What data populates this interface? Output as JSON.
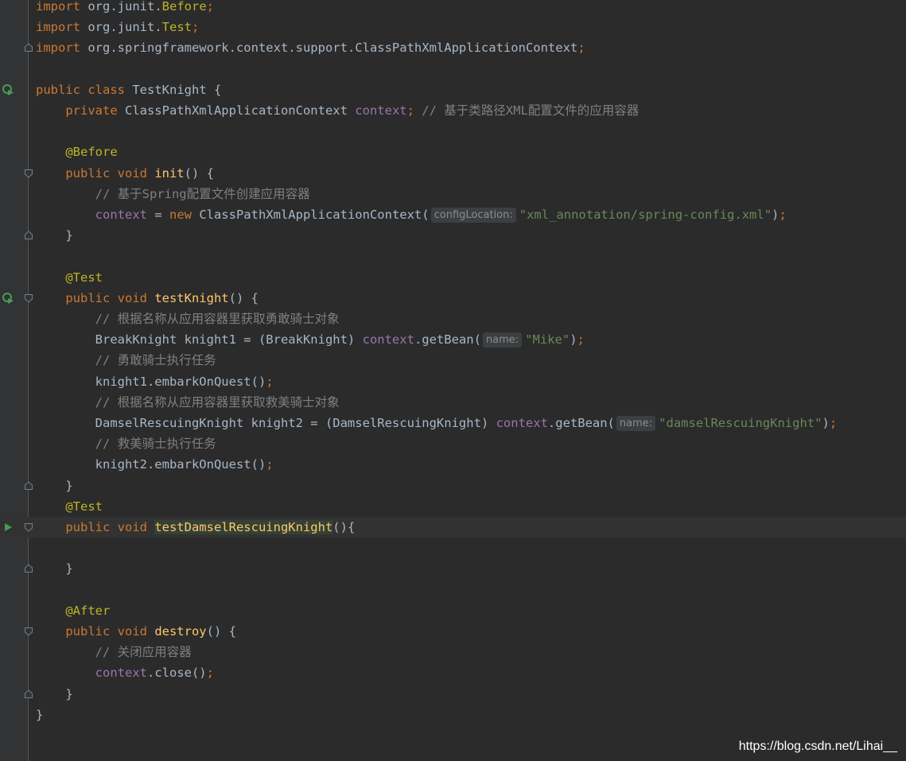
{
  "colors": {
    "background": "#2b2b2b",
    "gutter": "#313335",
    "keyword": "#cc7832",
    "annotation": "#bbb529",
    "field": "#9876aa",
    "string": "#6a8759",
    "comment": "#808080",
    "method_decl": "#ffc66d",
    "plain": "#a9b7c6",
    "hint_text": "#8c8c8c",
    "run_icon": "#499c54"
  },
  "editor": {
    "lines": [
      {
        "fold": "",
        "run": "",
        "tokens": [
          [
            "kw",
            "import"
          ],
          [
            "p",
            " org.junit."
          ],
          [
            "ann",
            "Before"
          ],
          [
            "kw",
            ";"
          ]
        ]
      },
      {
        "fold": "",
        "run": "",
        "tokens": [
          [
            "kw",
            "import"
          ],
          [
            "p",
            " org.junit."
          ],
          [
            "ann",
            "Test"
          ],
          [
            "kw",
            ";"
          ]
        ]
      },
      {
        "fold": "end",
        "run": "",
        "tokens": [
          [
            "kw",
            "import"
          ],
          [
            "p",
            " org.springframework.context.support.ClassPathXmlApplicationContext"
          ],
          [
            "kw",
            ";"
          ]
        ]
      },
      {
        "fold": "",
        "run": "",
        "tokens": []
      },
      {
        "fold": "",
        "run": "run-all",
        "tokens": [
          [
            "kw",
            "public class "
          ],
          [
            "p",
            "TestKnight {"
          ]
        ]
      },
      {
        "fold": "",
        "run": "",
        "tokens": [
          [
            "p",
            "    "
          ],
          [
            "kw",
            "private "
          ],
          [
            "p",
            "ClassPathXmlApplicationContext "
          ],
          [
            "fld",
            "context"
          ],
          [
            "kw",
            ";"
          ],
          [
            "p",
            " "
          ],
          [
            "cmt",
            "// 基于类路径XML配置文件的应用容器"
          ]
        ]
      },
      {
        "fold": "",
        "run": "",
        "tokens": []
      },
      {
        "fold": "",
        "run": "",
        "tokens": [
          [
            "p",
            "    "
          ],
          [
            "ann",
            "@Before"
          ]
        ]
      },
      {
        "fold": "start",
        "run": "",
        "tokens": [
          [
            "p",
            "    "
          ],
          [
            "kw",
            "public void "
          ],
          [
            "mth",
            "init"
          ],
          [
            "p",
            "() {"
          ]
        ]
      },
      {
        "fold": "",
        "run": "",
        "tokens": [
          [
            "p",
            "        "
          ],
          [
            "cmt",
            "// 基于Spring配置文件创建应用容器"
          ]
        ]
      },
      {
        "fold": "",
        "run": "",
        "tokens": [
          [
            "p",
            "        "
          ],
          [
            "fld",
            "context"
          ],
          [
            "p",
            " = "
          ],
          [
            "kw",
            "new "
          ],
          [
            "p",
            "ClassPathXmlApplicationContext("
          ],
          [
            "hint",
            "configLocation:"
          ],
          [
            "str",
            "\"xml_annotation/spring-config.xml\""
          ],
          [
            "p",
            ")"
          ],
          [
            "kw",
            ";"
          ]
        ]
      },
      {
        "fold": "end",
        "run": "",
        "tokens": [
          [
            "p",
            "    }"
          ]
        ]
      },
      {
        "fold": "",
        "run": "",
        "tokens": []
      },
      {
        "fold": "",
        "run": "",
        "tokens": [
          [
            "p",
            "    "
          ],
          [
            "ann",
            "@Test"
          ]
        ]
      },
      {
        "fold": "start",
        "run": "run-all",
        "tokens": [
          [
            "p",
            "    "
          ],
          [
            "kw",
            "public void "
          ],
          [
            "mth",
            "testKnight"
          ],
          [
            "p",
            "() {"
          ]
        ]
      },
      {
        "fold": "",
        "run": "",
        "tokens": [
          [
            "p",
            "        "
          ],
          [
            "cmt",
            "// 根据名称从应用容器里获取勇敢骑士对象"
          ]
        ]
      },
      {
        "fold": "",
        "run": "",
        "tokens": [
          [
            "p",
            "        BreakKnight knight1 = (BreakKnight) "
          ],
          [
            "fld",
            "context"
          ],
          [
            "p",
            ".getBean("
          ],
          [
            "hint",
            "name:"
          ],
          [
            "str",
            "\"Mike\""
          ],
          [
            "p",
            ")"
          ],
          [
            "kw",
            ";"
          ]
        ]
      },
      {
        "fold": "",
        "run": "",
        "tokens": [
          [
            "p",
            "        "
          ],
          [
            "cmt",
            "// 勇敢骑士执行任务"
          ]
        ]
      },
      {
        "fold": "",
        "run": "",
        "tokens": [
          [
            "p",
            "        knight1.embarkOnQuest()"
          ],
          [
            "kw",
            ";"
          ]
        ]
      },
      {
        "fold": "",
        "run": "",
        "tokens": [
          [
            "p",
            "        "
          ],
          [
            "cmt",
            "// 根据名称从应用容器里获取救美骑士对象"
          ]
        ]
      },
      {
        "fold": "",
        "run": "",
        "tokens": [
          [
            "p",
            "        DamselRescuingKnight knight2 = (DamselRescuingKnight) "
          ],
          [
            "fld",
            "context"
          ],
          [
            "p",
            ".getBean("
          ],
          [
            "hint",
            "name:"
          ],
          [
            "str",
            "\"damselRescuingKnight\""
          ],
          [
            "p",
            ")"
          ],
          [
            "kw",
            ";"
          ]
        ]
      },
      {
        "fold": "",
        "run": "",
        "tokens": [
          [
            "p",
            "        "
          ],
          [
            "cmt",
            "// 救美骑士执行任务"
          ]
        ]
      },
      {
        "fold": "",
        "run": "",
        "tokens": [
          [
            "p",
            "        knight2.embarkOnQuest()"
          ],
          [
            "kw",
            ";"
          ]
        ]
      },
      {
        "fold": "end",
        "run": "",
        "tokens": [
          [
            "p",
            "    }"
          ]
        ]
      },
      {
        "fold": "",
        "run": "",
        "tokens": [
          [
            "p",
            "    "
          ],
          [
            "ann",
            "@Test"
          ]
        ]
      },
      {
        "fold": "start",
        "run": "run",
        "current": true,
        "tokens": [
          [
            "p",
            "    "
          ],
          [
            "kw",
            "public void "
          ],
          [
            "mthhl",
            "testDamselRescuingKnight"
          ],
          [
            "p",
            "(){"
          ]
        ]
      },
      {
        "fold": "",
        "run": "",
        "tokens": []
      },
      {
        "fold": "end",
        "run": "",
        "tokens": [
          [
            "p",
            "    }"
          ]
        ]
      },
      {
        "fold": "",
        "run": "",
        "tokens": []
      },
      {
        "fold": "",
        "run": "",
        "tokens": [
          [
            "p",
            "    "
          ],
          [
            "ann",
            "@After"
          ]
        ]
      },
      {
        "fold": "start",
        "run": "",
        "tokens": [
          [
            "p",
            "    "
          ],
          [
            "kw",
            "public void "
          ],
          [
            "mth",
            "destroy"
          ],
          [
            "p",
            "() {"
          ]
        ]
      },
      {
        "fold": "",
        "run": "",
        "tokens": [
          [
            "p",
            "        "
          ],
          [
            "cmt",
            "// 关闭应用容器"
          ]
        ]
      },
      {
        "fold": "",
        "run": "",
        "tokens": [
          [
            "p",
            "        "
          ],
          [
            "fld",
            "context"
          ],
          [
            "p",
            ".close()"
          ],
          [
            "kw",
            ";"
          ]
        ]
      },
      {
        "fold": "end",
        "run": "",
        "tokens": [
          [
            "p",
            "    }"
          ]
        ]
      },
      {
        "fold": "",
        "run": "",
        "tokens": [
          [
            "p",
            "}"
          ]
        ]
      }
    ]
  },
  "watermark": "https://blog.csdn.net/Lihai__"
}
